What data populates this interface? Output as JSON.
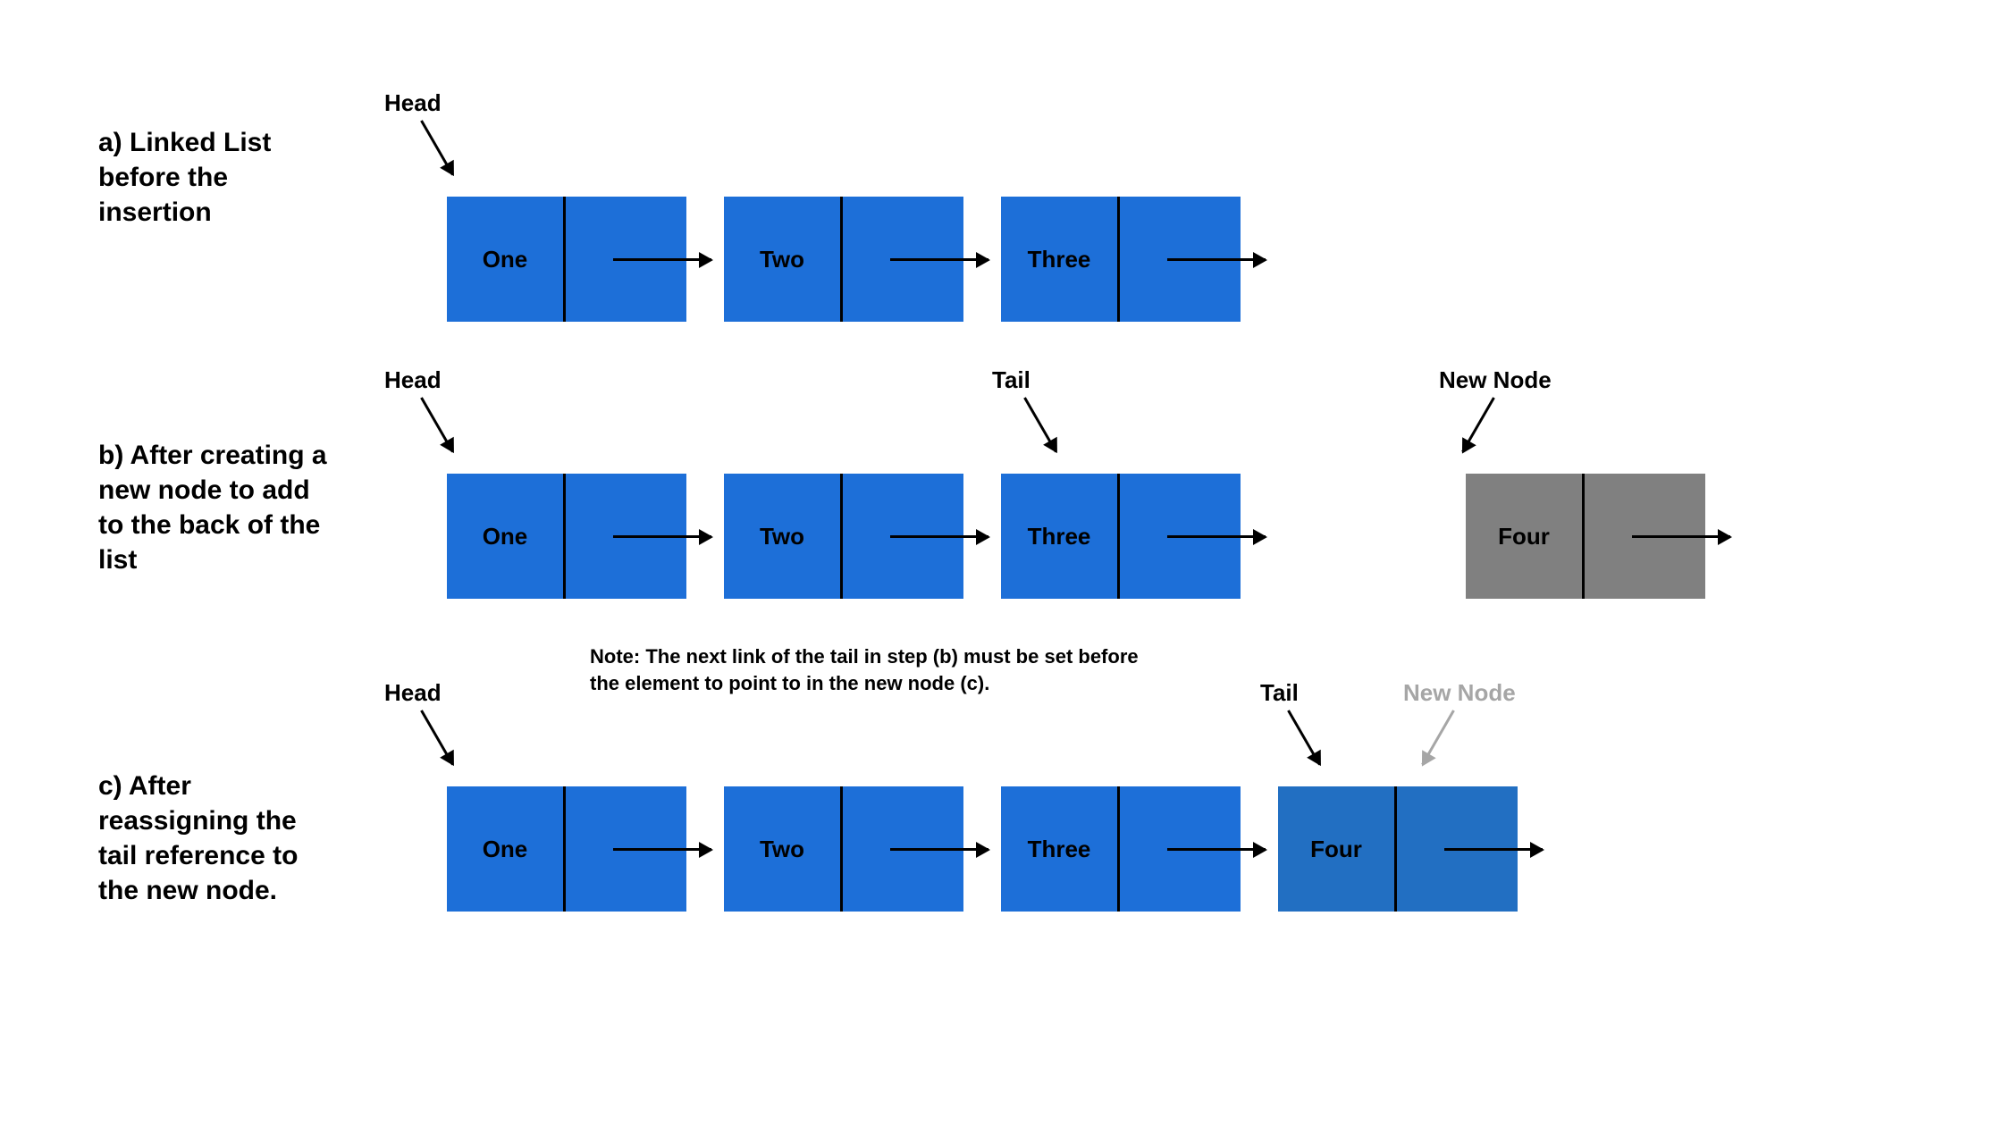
{
  "rowA": {
    "desc": "a) Linked List before the insertion",
    "headLabel": "Head",
    "nodes": [
      "One",
      "Two",
      "Three"
    ]
  },
  "rowB": {
    "desc": "b) After creating a new node to add to the back of the list",
    "headLabel": "Head",
    "tailLabel": "Tail",
    "newLabel": "New Node",
    "nodes": [
      "One",
      "Two",
      "Three"
    ],
    "newNode": "Four"
  },
  "rowC": {
    "desc": "c) After reassigning the tail reference to the new node.",
    "headLabel": "Head",
    "tailLabel": "Tail",
    "newLabel": "New Node",
    "note": "Note: The next link of the tail in step (b) must be set before the element to point to in the new node (c).",
    "nodes": [
      "One",
      "Two",
      "Three",
      "Four"
    ]
  }
}
